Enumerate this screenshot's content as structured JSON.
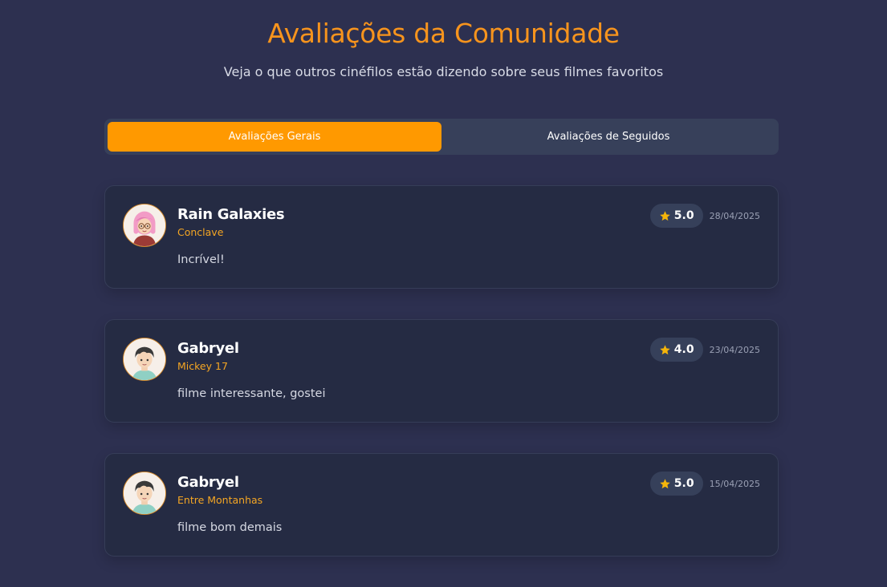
{
  "header": {
    "title": "Avaliações da Comunidade",
    "subtitle": "Veja o que outros cinéfilos estão dizendo sobre seus filmes favoritos"
  },
  "tabs": [
    {
      "label": "Avaliações Gerais",
      "active": true
    },
    {
      "label": "Avaliações de Seguidos",
      "active": false
    }
  ],
  "colors": {
    "accent": "#ff9900",
    "title": "#f7941d",
    "movie": "#f5a623",
    "star": "#f5b50a",
    "background": "#2d3050",
    "card": "#252b43"
  },
  "reviews": [
    {
      "user": "Rain Galaxies",
      "avatar_icon": "avatar-girl-pink-hair-glasses-icon",
      "movie": "Conclave",
      "rating": "5.0",
      "date": "28/04/2025",
      "comment": "Incrível!"
    },
    {
      "user": "Gabryel",
      "avatar_icon": "avatar-boy-dark-hair-icon",
      "movie": "Mickey 17",
      "rating": "4.0",
      "date": "23/04/2025",
      "comment": "filme interessante, gostei"
    },
    {
      "user": "Gabryel",
      "avatar_icon": "avatar-boy-dark-hair-icon",
      "movie": "Entre Montanhas",
      "rating": "5.0",
      "date": "15/04/2025",
      "comment": "filme bom demais"
    }
  ]
}
